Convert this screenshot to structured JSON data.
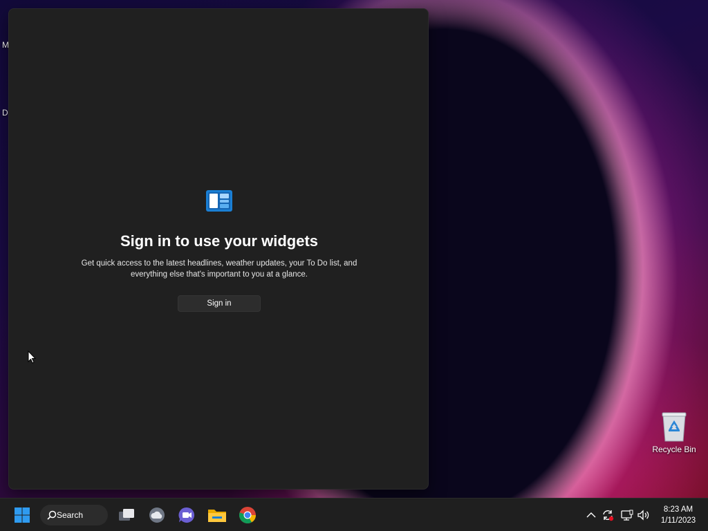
{
  "desktop": {
    "labels": [
      "M",
      "D"
    ],
    "recycle_bin_label": "Recycle Bin"
  },
  "widgets_panel": {
    "title": "Sign in to use your widgets",
    "description": "Get quick access to the latest headlines, weather updates, your To Do list, and everything else that's important to you at a glance.",
    "signin_label": "Sign in",
    "accent_color": "#1a7fd4"
  },
  "taskbar": {
    "start_icon": "windows-logo-icon",
    "search_label": "Search",
    "pinned": [
      {
        "name": "task-view",
        "icon": "task-view-icon"
      },
      {
        "name": "widgets",
        "icon": "weather-cloud-icon"
      },
      {
        "name": "teams-chat",
        "icon": "teams-chat-icon"
      },
      {
        "name": "file-explorer",
        "icon": "folder-icon"
      },
      {
        "name": "chrome",
        "icon": "chrome-icon"
      }
    ],
    "tray": {
      "icons": [
        "chevron-up-icon",
        "sync-icon",
        "network-icon",
        "volume-icon"
      ],
      "time": "8:23 AM",
      "date": "1/11/2023"
    }
  }
}
